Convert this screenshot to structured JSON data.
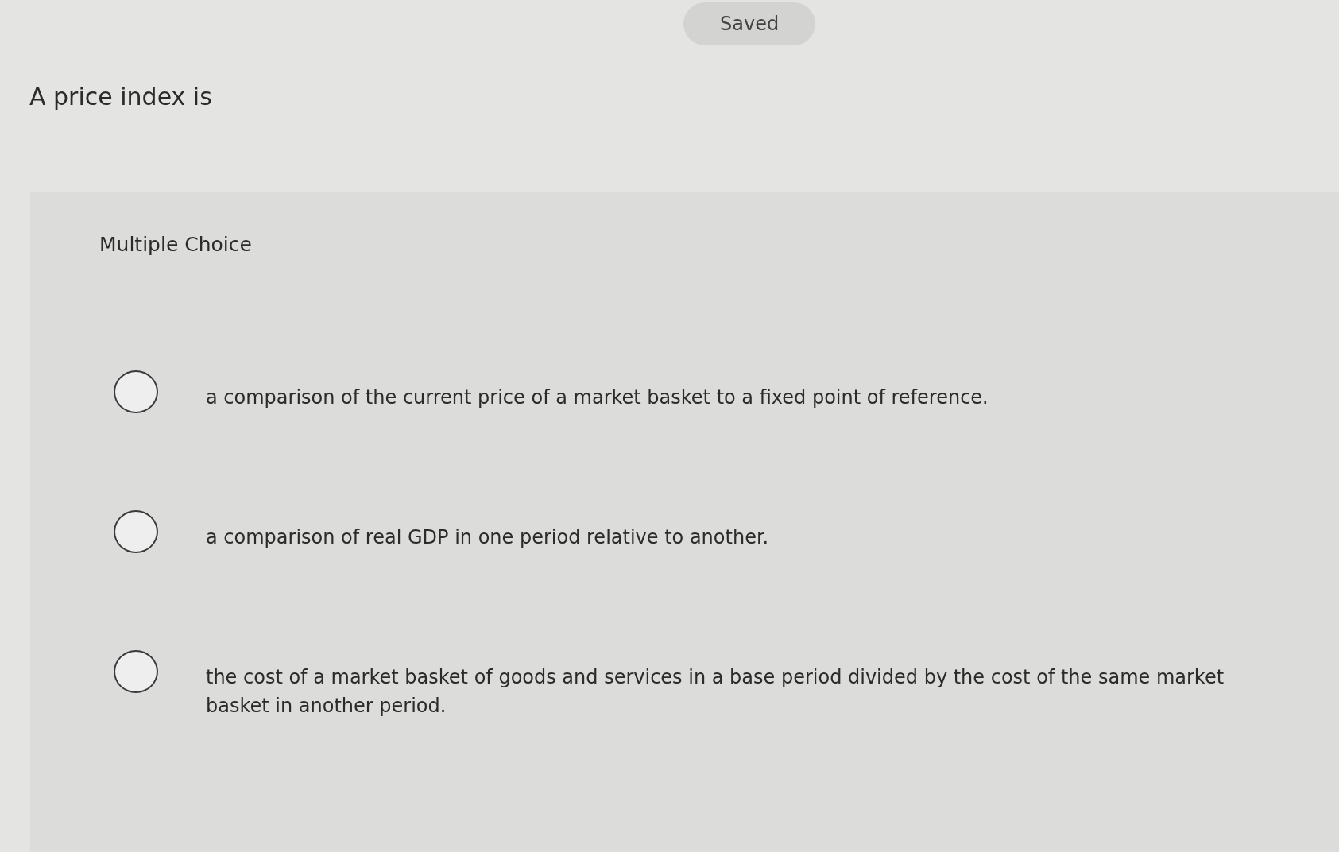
{
  "status_badge": {
    "label": "Saved"
  },
  "question": {
    "prompt": "A price index is"
  },
  "answer_panel": {
    "type_label": "Multiple Choice",
    "options": [
      {
        "text": "a comparison of the current price of a market basket to a fixed point of reference.",
        "selected": false
      },
      {
        "text": "a comparison of real GDP in one period relative to another.",
        "selected": false
      },
      {
        "text": "the cost of a market basket of goods and services in a base period divided by the cost of the same market basket in another period.",
        "selected": false
      }
    ]
  }
}
